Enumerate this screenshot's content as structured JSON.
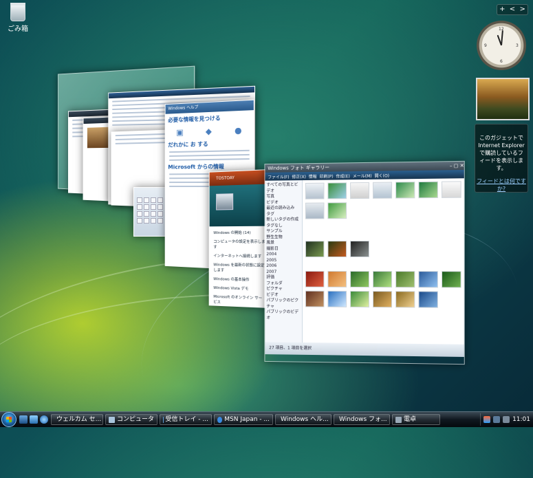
{
  "desktop": {
    "recycle_bin_label": "ごみ箱"
  },
  "sidebar": {
    "controls": [
      "+",
      "<",
      ">"
    ],
    "feed_message": "このガジェットで Internet Explorer で購読しているフィードを表示します。",
    "feed_link": "フィードとは何ですか?"
  },
  "clock_labels": [
    "12",
    "3",
    "6",
    "9"
  ],
  "welcome": {
    "header": "Windows ヘルプ",
    "heading": "必要な情報を見つける",
    "subheading": "Microsoft からの情報",
    "item": "だれかに お する"
  },
  "control_panel": {
    "banner": "TOSTOAY",
    "items": [
      "Windows の開始 (14)",
      "コンピュータの設定を表示します",
      "インターネットへ接続します",
      "Windows を最新の状態に設定します",
      "Windows の基本操作",
      "Windows Vista デモ",
      "Microsoft のオンライン サービス"
    ]
  },
  "gallery": {
    "title": "Windows フォト ギャラリー",
    "toolbar": [
      "ファイル(F)",
      "修正(X)",
      "情報",
      "印刷(P)",
      "作成(E)",
      "メール(M)",
      "開く(O)"
    ],
    "nav": [
      "すべての写真とビデオ",
      "写真",
      "ビデオ",
      "最近の読み込み",
      "タグ",
      "新しいタグの作成",
      "タグなし",
      "サンプル",
      "野生生物",
      "風景",
      "撮影日",
      "2004",
      "2005",
      "2006",
      "2007",
      "評価",
      "フォルダ",
      "ピクチャ",
      "ビデオ",
      "パブリックのピクチャ",
      "パブリックのビデオ"
    ],
    "status": "27 項目、1 項目を選択"
  },
  "taskbar": {
    "tasks": [
      "ウェルカム セ...",
      "コンピュータ",
      "受信トレイ - ...",
      "MSN Japan - ...",
      "Windows ヘル...",
      "Windows フォ...",
      "電卓"
    ],
    "clock": "11:01"
  },
  "colors": {
    "accent": "#1b5d9c",
    "taskbar": "#101820"
  }
}
